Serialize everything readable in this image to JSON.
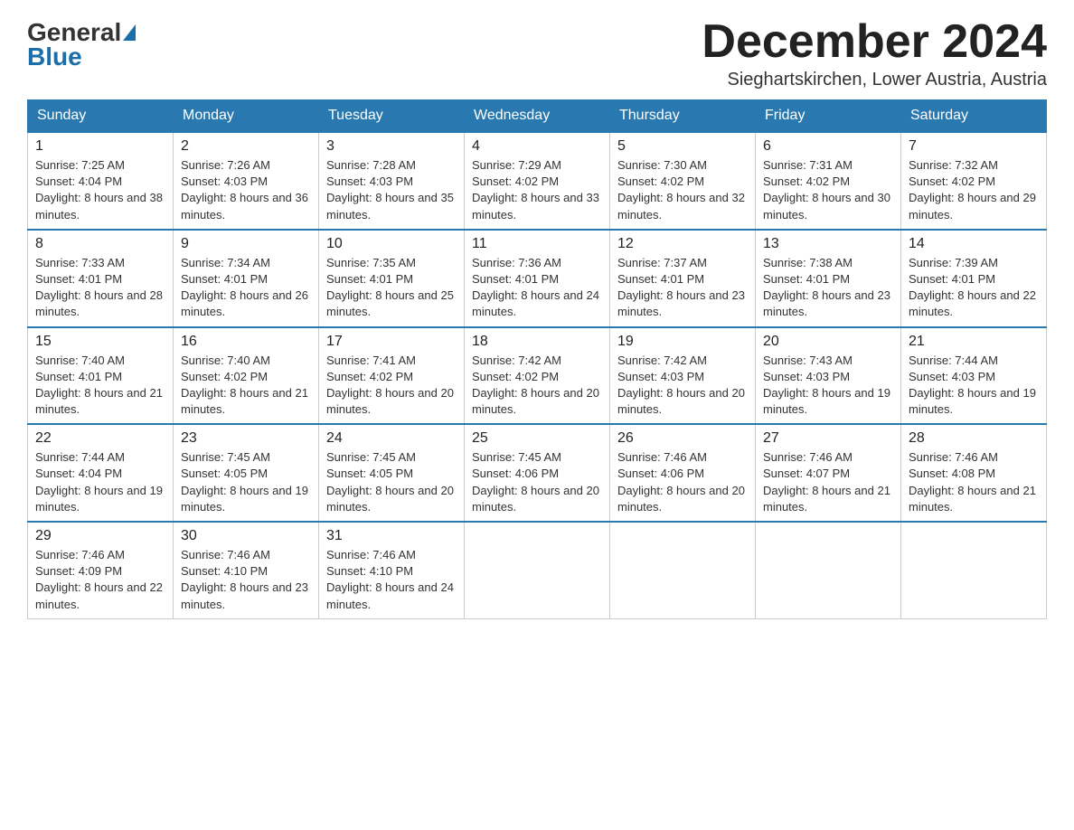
{
  "logo": {
    "general": "General",
    "blue": "Blue"
  },
  "header": {
    "month_title": "December 2024",
    "location": "Sieghartskirchen, Lower Austria, Austria"
  },
  "days_of_week": [
    "Sunday",
    "Monday",
    "Tuesday",
    "Wednesday",
    "Thursday",
    "Friday",
    "Saturday"
  ],
  "weeks": [
    [
      {
        "day": "1",
        "sunrise": "7:25 AM",
        "sunset": "4:04 PM",
        "daylight": "8 hours and 38 minutes."
      },
      {
        "day": "2",
        "sunrise": "7:26 AM",
        "sunset": "4:03 PM",
        "daylight": "8 hours and 36 minutes."
      },
      {
        "day": "3",
        "sunrise": "7:28 AM",
        "sunset": "4:03 PM",
        "daylight": "8 hours and 35 minutes."
      },
      {
        "day": "4",
        "sunrise": "7:29 AM",
        "sunset": "4:02 PM",
        "daylight": "8 hours and 33 minutes."
      },
      {
        "day": "5",
        "sunrise": "7:30 AM",
        "sunset": "4:02 PM",
        "daylight": "8 hours and 32 minutes."
      },
      {
        "day": "6",
        "sunrise": "7:31 AM",
        "sunset": "4:02 PM",
        "daylight": "8 hours and 30 minutes."
      },
      {
        "day": "7",
        "sunrise": "7:32 AM",
        "sunset": "4:02 PM",
        "daylight": "8 hours and 29 minutes."
      }
    ],
    [
      {
        "day": "8",
        "sunrise": "7:33 AM",
        "sunset": "4:01 PM",
        "daylight": "8 hours and 28 minutes."
      },
      {
        "day": "9",
        "sunrise": "7:34 AM",
        "sunset": "4:01 PM",
        "daylight": "8 hours and 26 minutes."
      },
      {
        "day": "10",
        "sunrise": "7:35 AM",
        "sunset": "4:01 PM",
        "daylight": "8 hours and 25 minutes."
      },
      {
        "day": "11",
        "sunrise": "7:36 AM",
        "sunset": "4:01 PM",
        "daylight": "8 hours and 24 minutes."
      },
      {
        "day": "12",
        "sunrise": "7:37 AM",
        "sunset": "4:01 PM",
        "daylight": "8 hours and 23 minutes."
      },
      {
        "day": "13",
        "sunrise": "7:38 AM",
        "sunset": "4:01 PM",
        "daylight": "8 hours and 23 minutes."
      },
      {
        "day": "14",
        "sunrise": "7:39 AM",
        "sunset": "4:01 PM",
        "daylight": "8 hours and 22 minutes."
      }
    ],
    [
      {
        "day": "15",
        "sunrise": "7:40 AM",
        "sunset": "4:01 PM",
        "daylight": "8 hours and 21 minutes."
      },
      {
        "day": "16",
        "sunrise": "7:40 AM",
        "sunset": "4:02 PM",
        "daylight": "8 hours and 21 minutes."
      },
      {
        "day": "17",
        "sunrise": "7:41 AM",
        "sunset": "4:02 PM",
        "daylight": "8 hours and 20 minutes."
      },
      {
        "day": "18",
        "sunrise": "7:42 AM",
        "sunset": "4:02 PM",
        "daylight": "8 hours and 20 minutes."
      },
      {
        "day": "19",
        "sunrise": "7:42 AM",
        "sunset": "4:03 PM",
        "daylight": "8 hours and 20 minutes."
      },
      {
        "day": "20",
        "sunrise": "7:43 AM",
        "sunset": "4:03 PM",
        "daylight": "8 hours and 19 minutes."
      },
      {
        "day": "21",
        "sunrise": "7:44 AM",
        "sunset": "4:03 PM",
        "daylight": "8 hours and 19 minutes."
      }
    ],
    [
      {
        "day": "22",
        "sunrise": "7:44 AM",
        "sunset": "4:04 PM",
        "daylight": "8 hours and 19 minutes."
      },
      {
        "day": "23",
        "sunrise": "7:45 AM",
        "sunset": "4:05 PM",
        "daylight": "8 hours and 19 minutes."
      },
      {
        "day": "24",
        "sunrise": "7:45 AM",
        "sunset": "4:05 PM",
        "daylight": "8 hours and 20 minutes."
      },
      {
        "day": "25",
        "sunrise": "7:45 AM",
        "sunset": "4:06 PM",
        "daylight": "8 hours and 20 minutes."
      },
      {
        "day": "26",
        "sunrise": "7:46 AM",
        "sunset": "4:06 PM",
        "daylight": "8 hours and 20 minutes."
      },
      {
        "day": "27",
        "sunrise": "7:46 AM",
        "sunset": "4:07 PM",
        "daylight": "8 hours and 21 minutes."
      },
      {
        "day": "28",
        "sunrise": "7:46 AM",
        "sunset": "4:08 PM",
        "daylight": "8 hours and 21 minutes."
      }
    ],
    [
      {
        "day": "29",
        "sunrise": "7:46 AM",
        "sunset": "4:09 PM",
        "daylight": "8 hours and 22 minutes."
      },
      {
        "day": "30",
        "sunrise": "7:46 AM",
        "sunset": "4:10 PM",
        "daylight": "8 hours and 23 minutes."
      },
      {
        "day": "31",
        "sunrise": "7:46 AM",
        "sunset": "4:10 PM",
        "daylight": "8 hours and 24 minutes."
      },
      null,
      null,
      null,
      null
    ]
  ]
}
